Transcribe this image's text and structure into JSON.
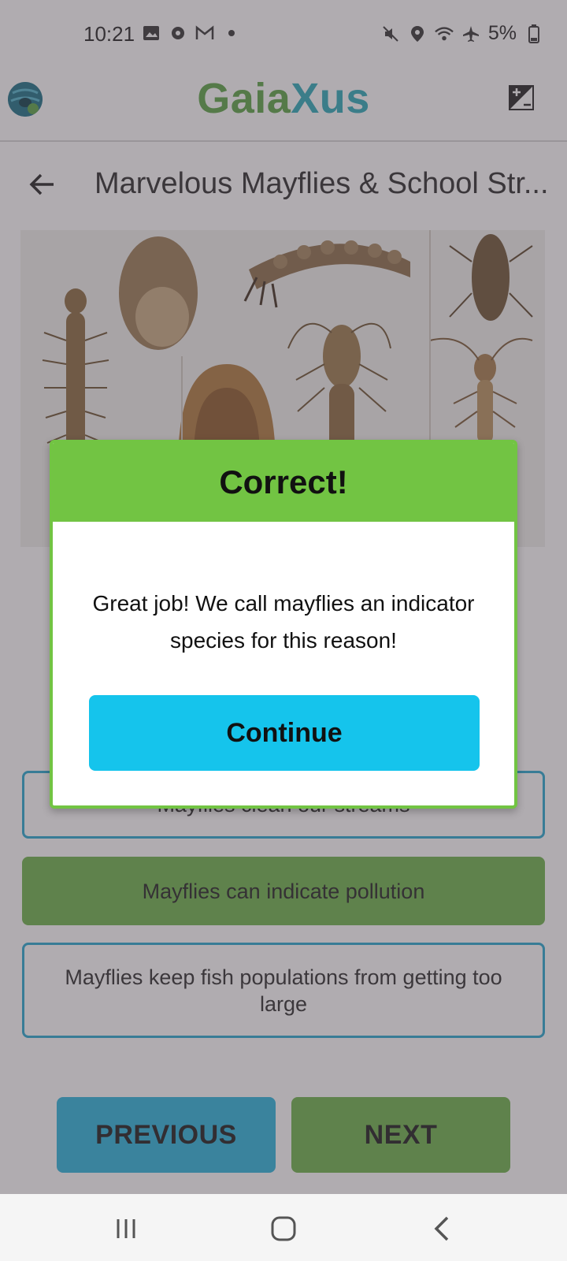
{
  "status_bar": {
    "time": "10:21",
    "battery": "5%",
    "left_icons": [
      "image-icon",
      "gear-icon",
      "gmail-icon",
      "dot-icon"
    ],
    "right_icons": [
      "mute-icon",
      "location-icon",
      "wifi-icon",
      "airplane-icon",
      "battery-icon"
    ]
  },
  "header": {
    "title_part1": "Gaia",
    "title_part2": "Xus",
    "brand_colors": {
      "gaia": "#5aa444",
      "xus": "#2aa9b8"
    }
  },
  "page": {
    "title": "Marvelous Mayflies & School Str..."
  },
  "options": [
    {
      "label": "Mayflies clean our streams",
      "state": "outline"
    },
    {
      "label": "Mayflies can indicate pollution",
      "state": "selected"
    },
    {
      "label": "Mayflies keep fish populations from getting too large",
      "state": "outline"
    }
  ],
  "nav": {
    "previous_label": "PREVIOUS",
    "next_label": "NEXT"
  },
  "dialog": {
    "title": "Correct!",
    "message": "Great job! We call mayflies an indicator species for this reason!",
    "continue_label": "Continue"
  },
  "colors": {
    "accent_green": "#72c443",
    "accent_blue": "#15c4ec",
    "option_border": "#25a8d0"
  }
}
